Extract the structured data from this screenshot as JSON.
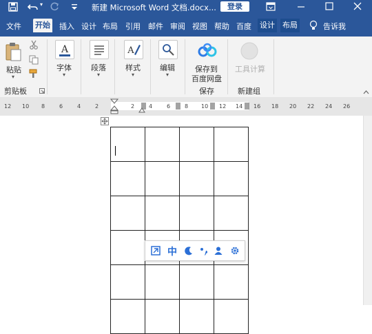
{
  "titlebar": {
    "title": "新建 Microsoft Word 文档.docx...",
    "login_label": "登录"
  },
  "tabs": [
    "文件",
    "开始",
    "插入",
    "设计",
    "布局",
    "引用",
    "邮件",
    "审阅",
    "视图",
    "帮助",
    "百度",
    "设计",
    "布局"
  ],
  "tell_me": "告诉我",
  "ribbon": {
    "clipboard": {
      "paste_label": "粘贴",
      "group_label": "剪贴板"
    },
    "font_label": "字体",
    "paragraph_label": "段落",
    "styles_label": "样式",
    "editing_label": "编辑",
    "save_baidu": {
      "line1": "保存到",
      "line2": "百度网盘",
      "group_label": "保存"
    },
    "tools": {
      "label": "工具计算",
      "group_label": "新建组"
    }
  },
  "ruler": {
    "ticks": [
      "12",
      "10",
      "8",
      "6",
      "4",
      "2",
      "2",
      "4",
      "6",
      "8",
      "10",
      "12",
      "14",
      "16",
      "18",
      "20",
      "22",
      "24",
      "26"
    ]
  },
  "ime_toolbar": {
    "chinese_label": "中"
  },
  "table": {
    "rows": 6,
    "cols": 4
  },
  "colors": {
    "accent": "#2b579a",
    "ribbon_bg": "#f3f3f3"
  }
}
